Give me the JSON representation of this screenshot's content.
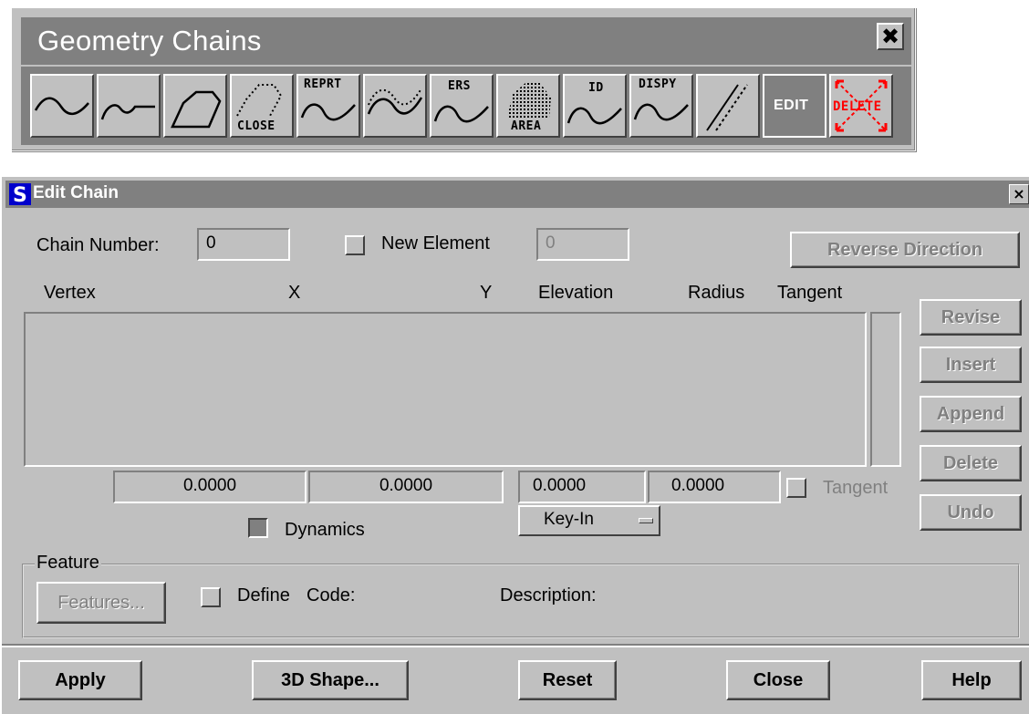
{
  "toolbar": {
    "title": "Geometry Chains",
    "close_glyph": "✖",
    "tools": [
      {
        "name": "chain-open-tool",
        "label": ""
      },
      {
        "name": "chain-curve-tool",
        "label": ""
      },
      {
        "name": "chain-shape-tool",
        "label": ""
      },
      {
        "name": "chain-close-tool",
        "label": "CLOSE"
      },
      {
        "name": "chain-reprt-tool",
        "label": "REPRT"
      },
      {
        "name": "chain-dotted-tool",
        "label": ""
      },
      {
        "name": "chain-ers-tool",
        "label": "ERS"
      },
      {
        "name": "chain-area-tool",
        "label": "AREA"
      },
      {
        "name": "chain-id-tool",
        "label": "ID"
      },
      {
        "name": "chain-dispy-tool",
        "label": "DISPY"
      },
      {
        "name": "chain-parallel-tool",
        "label": ""
      },
      {
        "name": "chain-edit-tool",
        "label": "EDIT"
      },
      {
        "name": "chain-delete-tool",
        "label": "DELETE"
      }
    ]
  },
  "dialog": {
    "title": "Edit Chain",
    "close_glyph": "×",
    "chain_number_label": "Chain Number:",
    "chain_number_value": "0",
    "new_element_label": "New Element",
    "new_element_value": "0",
    "reverse_direction_label": "Reverse Direction",
    "columns": {
      "vertex": "Vertex",
      "x": "X",
      "y": "Y",
      "elevation": "Elevation",
      "radius": "Radius",
      "tangent": "Tangent"
    },
    "side_buttons": {
      "revise": "Revise",
      "insert": "Insert",
      "append": "Append",
      "delete": "Delete",
      "undo": "Undo"
    },
    "inputs": {
      "x": "0.0000",
      "y": "0.0000",
      "elevation": "0.0000",
      "radius": "0.0000"
    },
    "tangent_label": "Tangent",
    "dynamics_label": "Dynamics",
    "keyin_value": "Key-In",
    "feature": {
      "legend": "Feature",
      "features_button": "Features...",
      "define_label": "Define",
      "code_label": "Code:",
      "description_label": "Description:"
    },
    "bottom_buttons": {
      "apply": "Apply",
      "shape3d": "3D Shape...",
      "reset": "Reset",
      "close": "Close",
      "help": "Help"
    }
  }
}
